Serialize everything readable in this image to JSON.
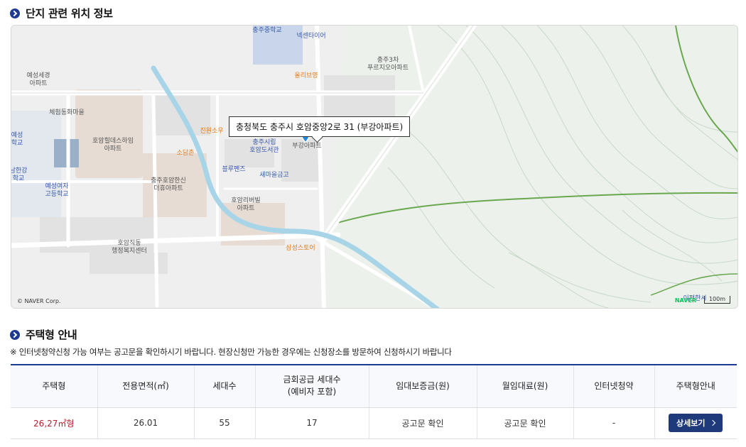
{
  "location_section": {
    "title": "단지 관련 위치 정보"
  },
  "map": {
    "tooltip": "충청북도 충주시 호암중앙2로 31 (부강아파트)",
    "copyright": "© NAVER Corp.",
    "brand": "NAVER",
    "scale": "100m",
    "pois": [
      {
        "label": "충주중학교"
      },
      {
        "label": "넥센타이어"
      },
      {
        "label": "올리브영"
      },
      {
        "label": "충주3차\n푸르지오아파트"
      },
      {
        "label": "예성세경\n아파트"
      },
      {
        "label": "체험동화마을"
      },
      {
        "label": "호암힐데스하임\n아파트"
      },
      {
        "label": "진원소우"
      },
      {
        "label": "소담촌"
      },
      {
        "label": "충주시립\n호암도서관"
      },
      {
        "label": "부강아파트"
      },
      {
        "label": "블루펜즈"
      },
      {
        "label": "새마을금고"
      },
      {
        "label": "충주호암한신\n더휴아파트"
      },
      {
        "label": "호암리버빌\n아파트"
      },
      {
        "label": "예성여자\n고등학교"
      },
      {
        "label": "호암직동\n행정복지센터"
      },
      {
        "label": "삼성스토어"
      },
      {
        "label": "예성\n학교"
      },
      {
        "label": "남한강\n학교"
      },
      {
        "label": "이편한시"
      }
    ]
  },
  "housing_section": {
    "title": "주택형 안내",
    "notice": "※ 인터넷청약신청 가능 여부는 공고문을 확인하시기 바랍니다. 현장신청만 가능한 경우에는 신청장소를 방문하여 신청하시기 바랍니다"
  },
  "table": {
    "headers": [
      "주택형",
      "전용면적(㎡)",
      "세대수",
      "금회공급 세대수\n(예비자 포함)",
      "임대보증금(원)",
      "월임대료(원)",
      "인터넷청약",
      "주택형안내"
    ],
    "rows": [
      {
        "type": "26,27㎡형",
        "area": "26.01",
        "units": "55",
        "supply": "17",
        "deposit": "공고문 확인",
        "rent": "공고문 확인",
        "online": "-",
        "button": "상세보기"
      }
    ]
  },
  "colors": {
    "accent": "#1f3a93",
    "button": "#1f3a7a",
    "type_text": "#b32030",
    "river": "#a8d4e8",
    "boundary": "#6aa84f"
  }
}
